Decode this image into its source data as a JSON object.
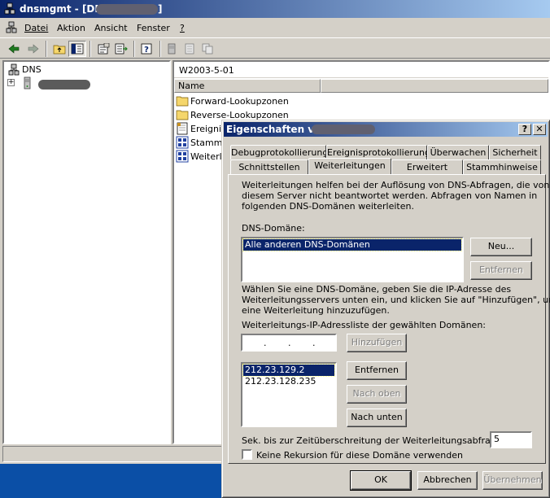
{
  "window": {
    "title_prefix": "dnsmgmt - [DNS\\",
    "title_suffix": "]"
  },
  "menu": {
    "items": [
      "Datei",
      "Aktion",
      "Ansicht",
      "Fenster",
      "?"
    ]
  },
  "toolbar": {
    "buttons": [
      "back-icon",
      "forward-icon",
      "up-folder-icon",
      "show-hide-tree-icon",
      "properties-icon",
      "export-list-icon",
      "help-icon",
      "server-icon",
      "document-icon",
      "copy-icon"
    ]
  },
  "tree": {
    "root_label": "DNS",
    "expander": "+"
  },
  "right_pane": {
    "header": "W2003-5-01",
    "column_name": "Name",
    "items": [
      "Forward-Lookupzonen",
      "Reverse-Lookupzonen",
      "Ereignis",
      "Stammh",
      "Weiterle"
    ]
  },
  "dialog": {
    "title": "Eigenschaften von",
    "help_btn": "?",
    "close_btn": "✕",
    "tabs_row1": [
      "Debugprotokollierung",
      "Ereignisprotokollierung",
      "Überwachen",
      "Sicherheit"
    ],
    "tabs_row2": [
      "Schnittstellen",
      "Weiterleitungen",
      "Erweitert",
      "Stammhinweise"
    ],
    "description": [
      "Weiterleitungen helfen bei der Auflösung von DNS-Abfragen, die von",
      "diesem Server nicht beantwortet werden. Abfragen von Namen in",
      "folgenden DNS-Domänen weiterleiten."
    ],
    "domain_label": "DNS-Domäne:",
    "domain_list": [
      "Alle anderen DNS-Domänen"
    ],
    "btn_new": "Neu...",
    "btn_remove_domain": "Entfernen",
    "instruction": [
      "Wählen Sie eine DNS-Domäne, geben Sie die IP-Adresse des",
      "Weiterleitungsservers unten ein, und klicken Sie auf \"Hinzufügen\", um",
      "eine Weiterleitung hinzuzufügen."
    ],
    "ip_list_label": "Weiterleitungs-IP-Adressliste der gewählten Domänen:",
    "btn_add": "Hinzufügen",
    "ip_list": [
      "212.23.129.2",
      "212.23.128.235"
    ],
    "btn_remove_ip": "Entfernen",
    "btn_up": "Nach oben",
    "btn_down": "Nach unten",
    "timeout_label": "Sek. bis zur Zeitüberschreitung der Weiterleitungsabfragen:",
    "timeout_value": "5",
    "recursion_label": "Keine Rekursion für diese Domäne verwenden",
    "btn_ok": "OK",
    "btn_cancel": "Abbrechen",
    "btn_apply": "Übernehmen"
  }
}
